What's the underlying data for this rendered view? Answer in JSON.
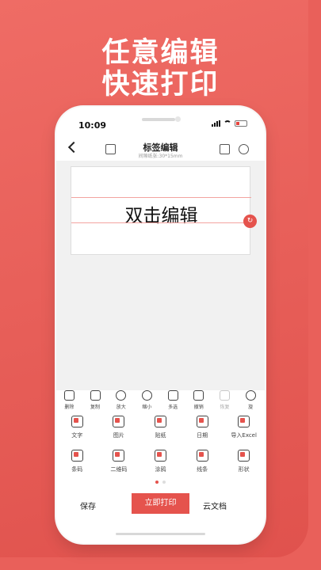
{
  "promo": {
    "headline_line1": "任意编辑",
    "headline_line2": "快速打印"
  },
  "status_bar": {
    "time": "10:09"
  },
  "navbar": {
    "title": "标签编辑",
    "subtitle": "间隙纸张:30*15mm",
    "icons": [
      "back-icon",
      "print-device-icon",
      "image-icon",
      "settings-icon"
    ]
  },
  "canvas": {
    "label_text": "双击编辑",
    "handle_icon": "rotate-icon"
  },
  "toolbar": {
    "items": [
      {
        "label": "删除",
        "icon": "trash-icon"
      },
      {
        "label": "复制",
        "icon": "copy-icon"
      },
      {
        "label": "放大",
        "icon": "zoom-in-icon"
      },
      {
        "label": "缩小",
        "icon": "zoom-out-icon"
      },
      {
        "label": "多选",
        "icon": "multi-select-icon"
      },
      {
        "label": "撤销",
        "icon": "undo-icon"
      },
      {
        "label": "恢复",
        "icon": "redo-icon"
      },
      {
        "label": "旋",
        "icon": "rotate-icon"
      }
    ]
  },
  "insert_grid": {
    "row1": [
      {
        "label": "文字",
        "icon": "text-icon"
      },
      {
        "label": "图片",
        "icon": "picture-icon"
      },
      {
        "label": "贴纸",
        "icon": "sticker-icon"
      },
      {
        "label": "日期",
        "icon": "calendar-icon"
      },
      {
        "label": "导入Excel",
        "icon": "excel-icon"
      }
    ],
    "row2": [
      {
        "label": "条码",
        "icon": "barcode-icon"
      },
      {
        "label": "二维码",
        "icon": "qrcode-icon"
      },
      {
        "label": "涂鸦",
        "icon": "pen-icon"
      },
      {
        "label": "线条",
        "icon": "line-icon"
      },
      {
        "label": "形状",
        "icon": "shape-icon"
      }
    ]
  },
  "pager": {
    "pages": 2,
    "current": 1
  },
  "bottom_bar": {
    "save_label": "保存",
    "print_label": "立即打印",
    "cloud_label": "云文档"
  },
  "colors": {
    "accent": "#e5534d",
    "background": "#e9605a"
  }
}
